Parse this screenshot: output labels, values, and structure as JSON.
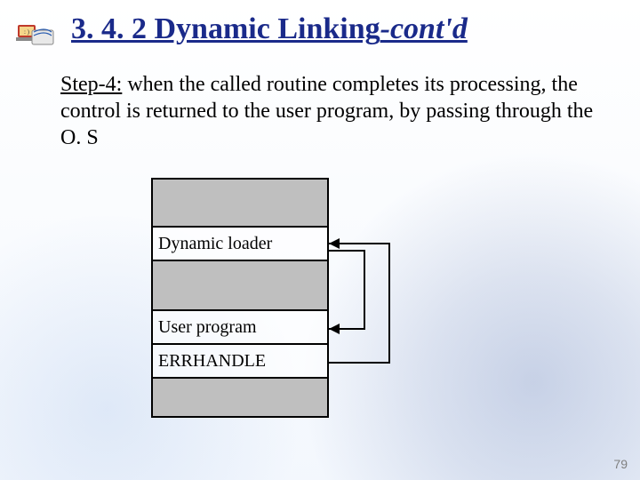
{
  "title": {
    "main": "3. 4. 2 Dynamic Linking",
    "contd": "-cont'd"
  },
  "body": {
    "step_label": "Step-4:",
    "text": " when the called routine completes its processing, the control is returned to the user program, by passing through the O. S"
  },
  "diagram": {
    "rows": [
      {
        "label": "",
        "shaded": true
      },
      {
        "label": "Dynamic loader",
        "shaded": false
      },
      {
        "label": "",
        "shaded": true
      },
      {
        "label": "User program",
        "shaded": false
      },
      {
        "label": "ERRHANDLE",
        "shaded": false
      },
      {
        "label": "",
        "shaded": true
      }
    ]
  },
  "page_number": "79"
}
